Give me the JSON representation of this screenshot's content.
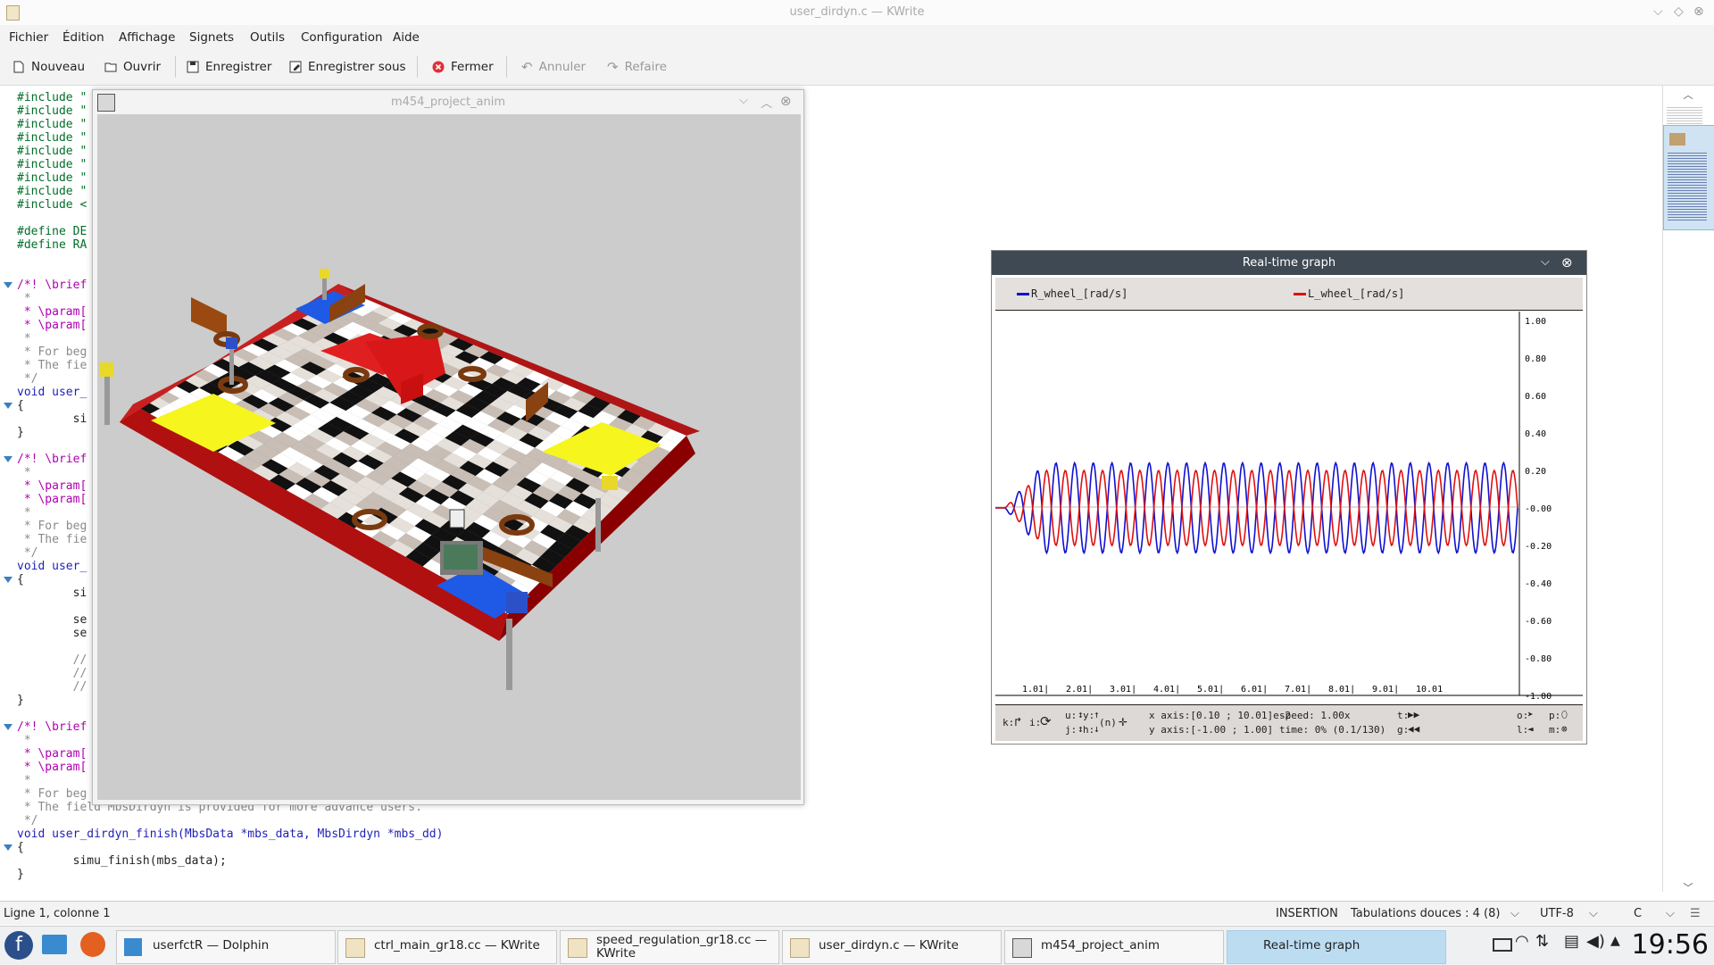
{
  "window": {
    "title": "user_dirdyn.c  — KWrite"
  },
  "menu": [
    "Fichier",
    "Édition",
    "Affichage",
    "Signets",
    "Outils",
    "Configuration",
    "Aide"
  ],
  "toolbar": {
    "new": "Nouveau",
    "open": "Ouvrir",
    "save": "Enregistrer",
    "save_as": "Enregistrer sous",
    "close": "Fermer",
    "undo": "Annuler",
    "redo": "Refaire"
  },
  "editor": {
    "lines": [
      "#include \"",
      "#include \"",
      "#include \"",
      "#include \"",
      "#include \"",
      "#include \"",
      "#include \"",
      "#include \"",
      "#include <",
      "",
      "#define DE",
      "#define RA",
      "",
      "",
      "/*! \\brief",
      " *",
      " * \\param[",
      " * \\param[",
      " *",
      " * For beg",
      " * The fie",
      " */",
      "void user_",
      "{",
      "        si",
      "}",
      "",
      "/*! \\brief",
      " *",
      " * \\param[",
      " * \\param[",
      " *",
      " * For beg",
      " * The fie",
      " */",
      "void user_",
      "{",
      "        si",
      "",
      "        se",
      "        se",
      "",
      "        //",
      "        //",
      "        //",
      "}",
      "",
      "/*! \\brief",
      " *",
      " * \\param[",
      " * \\param[",
      " *",
      " * For beg",
      " * The field MbsDirdyn is provided for more advance users.",
      " */",
      "void user_dirdyn_finish(MbsData *mbs_data, MbsDirdyn *mbs_dd)",
      "{",
      "        simu_finish(mbs_data);",
      "}"
    ]
  },
  "status": {
    "position": "Ligne 1, colonne 1",
    "mode": "INSERTION",
    "tabs": "Tabulations douces : 4 (8)",
    "encoding": "UTF-8",
    "highlight": "C"
  },
  "anim_window": {
    "title": "m454_project_anim"
  },
  "graph_window": {
    "title": "Real-time graph",
    "legend": [
      {
        "name": "R_wheel_[rad/s]",
        "color": "#1010d0"
      },
      {
        "name": "L_wheel_[rad/s]",
        "color": "#e01010"
      }
    ],
    "x_ticks": [
      "1.01|",
      "2.01|",
      "3.01|",
      "4.01|",
      "5.01|",
      "6.01|",
      "7.01|",
      "8.01|",
      "9.01|",
      "10.01"
    ],
    "y_ticks": [
      "1.00",
      "0.80",
      "0.60",
      "0.40",
      "0.20",
      "-0.00",
      "-0.20",
      "-0.40",
      "-0.60",
      "-0.80",
      "-1.00"
    ],
    "controls": {
      "k": "k:",
      "i": "i:",
      "u": "u:",
      "y": "y:",
      "j": "j:",
      "h": "h:",
      "n": "(n)",
      "x_axis": "x axis:[0.10 ; 10.01]e-2",
      "y_axis": "y axis:[-1.00 ; 1.00]",
      "speed": "speed: 1.00x",
      "time": "time:  0% (0.1/130)",
      "t": "t:",
      "g": "g:",
      "o": "o:",
      "l": "l:",
      "p": "p:",
      "m": "m:"
    }
  },
  "chart_data": {
    "type": "line",
    "title": "Real-time graph",
    "xlabel": "",
    "ylabel": "",
    "x_ticks": [
      "1.01|",
      "2.01|",
      "3.01|",
      "4.01|",
      "5.01|",
      "6.01|",
      "7.01|",
      "8.01|",
      "9.01|",
      "10.01"
    ],
    "ylim": [
      -1.0,
      1.0
    ],
    "series": [
      {
        "name": "R_wheel_[rad/s]",
        "color": "#1010d0",
        "amplitude": 0.24,
        "cycles": 28,
        "phase": 0
      },
      {
        "name": "L_wheel_[rad/s]",
        "color": "#e01010",
        "amplitude": 0.2,
        "cycles": 28,
        "phase": 3.14
      }
    ]
  },
  "taskbar": {
    "tasks": [
      "userfctR — Dolphin",
      "ctrl_main_gr18.cc  — KWrite",
      "speed_regulation_gr18.cc  — KWrite",
      "user_dirdyn.c  — KWrite",
      "m454_project_anim",
      "Real-time graph"
    ],
    "clock": "19:56"
  }
}
